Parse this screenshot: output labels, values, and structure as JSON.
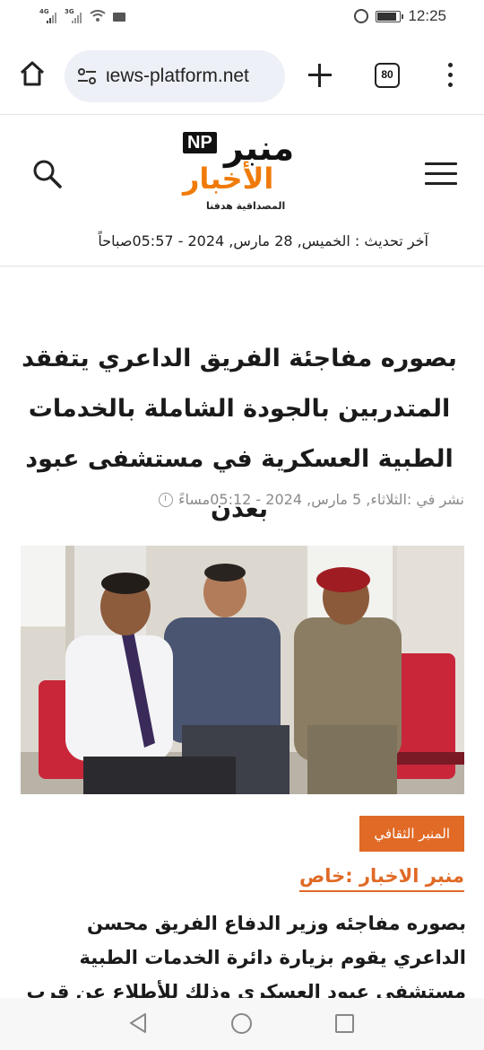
{
  "status_bar": {
    "network_1": "4G",
    "network_2": "3G",
    "time": "12:25",
    "battery_level": 0.85
  },
  "browser": {
    "url": "ιews-platform.net",
    "tab_count": "80"
  },
  "site": {
    "logo_badge": "NP",
    "logo_line1": "منبر",
    "logo_line2": "الأخبار",
    "tagline": "المصداقية هدفنا",
    "last_update": "آخر تحديث : الخميس, 28 مارس, 2024 - 05:57صباحاً"
  },
  "article": {
    "title": "بصوره مفاجئة الفريق الداعري يتفقد المتدربين بالجودة الشاملة بالخدمات الطبية العسكرية في مستشفى عبود بعدن",
    "published": "نشر في :الثلاثاء, 5 مارس, 2024 - 05:12مساءً",
    "category": "المنبر الثقافي",
    "source": "منبر الاخبار :خاص",
    "body": "بصوره مفاجئه وزير الدفاع الفريق محسن الداعري يقوم بزيارة دائرة الخدمات الطبية مستشفى عبود العسكري وذلك للأطلاع عن قرب عن برنامج الجودة"
  },
  "icons": {
    "home": "home-icon",
    "site_settings": "tune-icon",
    "new_tab": "plus-icon",
    "tabs": "tabs-icon",
    "overflow": "more-vert-icon",
    "search": "search-icon",
    "menu": "hamburger-icon",
    "clock": "clock-icon",
    "back": "back-triangle-icon",
    "nav_home": "circle-icon",
    "recents": "square-icon"
  },
  "colors": {
    "accent": "#e06a26",
    "logo_orange": "#f07b0a",
    "url_pill": "#eef0f7"
  }
}
